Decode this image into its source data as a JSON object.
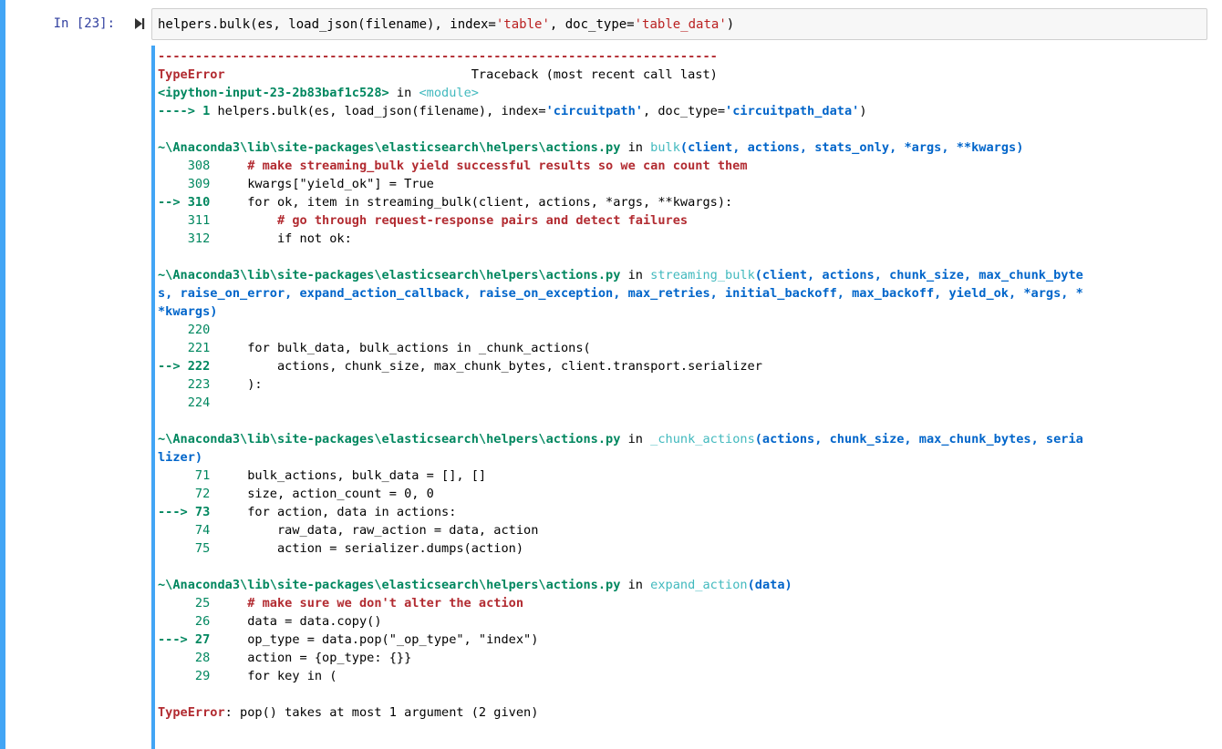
{
  "cell": {
    "prompt": "In [23]:",
    "code_parts": [
      "helpers.bulk(es, load_json(filename), index=",
      "'table'",
      ", doc_type=",
      "'table_data'",
      ")"
    ]
  },
  "traceback": {
    "dashes": "---------------------------------------------------------------------------",
    "error_type": "TypeError",
    "header_right": "Traceback (most recent call last)",
    "input_ref": "<ipython-input-23-2b83baf1c528>",
    "module": "<module>",
    "first_arrow": "----> 1 ",
    "first_code": "helpers.bulk(es, load_json(filename), index=",
    "first_str1": "'circuitpath'",
    "first_mid": ", doc_type=",
    "first_str2": "'circuitpath_data'",
    "first_end": ")",
    "path": "~\\Anaconda3\\lib\\site-packages\\elasticsearch\\helpers\\actions.py",
    "frame1": {
      "func": "bulk",
      "args": "(client, actions, stats_only, *args, **kwargs)",
      "lines": [
        {
          "no": "    308",
          "code": "# make streaming_bulk yield successful results so we can count them"
        },
        {
          "no": "    309",
          "code": "kwargs[\"yield_ok\"] = True"
        },
        {
          "no": "--> 310",
          "code": "for ok, item in streaming_bulk(client, actions, *args, **kwargs):"
        },
        {
          "no": "    311",
          "code": "    # go through request-response pairs and detect failures"
        },
        {
          "no": "    312",
          "code": "    if not ok:"
        }
      ]
    },
    "frame2": {
      "func": "streaming_bulk",
      "args1": "(client, actions, chunk_size, max_chunk_byte",
      "args2": "s, raise_on_error, expand_action_callback, raise_on_exception, max_retries, initial_backoff, max_backoff, yield_ok, *args, *",
      "args3": "*kwargs)",
      "lines": [
        {
          "no": "    220",
          "code": ""
        },
        {
          "no": "    221",
          "code": "for bulk_data, bulk_actions in _chunk_actions("
        },
        {
          "no": "--> 222",
          "code": "    actions, chunk_size, max_chunk_bytes, client.transport.serializer"
        },
        {
          "no": "    223",
          "code": "):"
        },
        {
          "no": "    224",
          "code": ""
        }
      ]
    },
    "frame3": {
      "func": "_chunk_actions",
      "args1": "(actions, chunk_size, max_chunk_bytes, seria",
      "args2": "lizer)",
      "lines": [
        {
          "no": "     71",
          "code": "bulk_actions, bulk_data = [], []"
        },
        {
          "no": "     72",
          "code": "size, action_count = 0, 0"
        },
        {
          "no": "---> 73",
          "code": "for action, data in actions:"
        },
        {
          "no": "     74",
          "code": "    raw_data, raw_action = data, action"
        },
        {
          "no": "     75",
          "code": "    action = serializer.dumps(action)"
        }
      ]
    },
    "frame4": {
      "func": "expand_action",
      "args": "(data)",
      "lines": [
        {
          "no": "     25",
          "code": "# make sure we don't alter the action"
        },
        {
          "no": "     26",
          "code": "data = data.copy()"
        },
        {
          "no": "---> 27",
          "code": "op_type = data.pop(\"_op_type\", \"index\")"
        },
        {
          "no": "     28",
          "code": "action = {op_type: {}}"
        },
        {
          "no": "     29",
          "code": "for key in ("
        }
      ]
    },
    "in_word": " in ",
    "final_error": "TypeError",
    "final_message": ": pop() takes at most 1 argument (2 given)"
  }
}
